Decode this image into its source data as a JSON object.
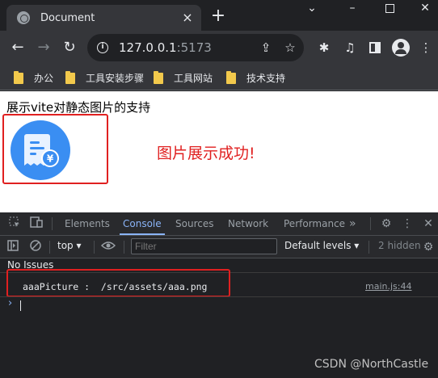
{
  "browser": {
    "tab": {
      "title": "Document"
    },
    "address": {
      "host": "127.0.0.1",
      "port": ":5173"
    },
    "bookmarks": [
      {
        "label": "办公"
      },
      {
        "label": "工具安装步骤"
      },
      {
        "label": "工具网站"
      },
      {
        "label": "技术支持"
      }
    ]
  },
  "page": {
    "heading": "展示vite对静态图片的支持",
    "success_message": "图片展示成功!",
    "logo_icon": "receipt-yen-icon",
    "colors": {
      "highlight": "#e02020",
      "logo_blue": "#3a8ef2",
      "success_text": "#e02020"
    }
  },
  "devtools": {
    "tabs": [
      {
        "label": "Elements"
      },
      {
        "label": "Console"
      },
      {
        "label": "Sources"
      },
      {
        "label": "Network"
      },
      {
        "label": "Performance"
      }
    ],
    "active_tab": "Console",
    "more_tabs": "»",
    "console": {
      "context": "top",
      "filter_placeholder": "Filter",
      "levels": "Default levels",
      "hidden_count": "2 hidden",
      "issues": "No Issues",
      "log": {
        "text": "aaaPicture :  /src/assets/aaa.png",
        "source": "main.js:44"
      }
    }
  },
  "watermark": "CSDN @NorthCastle"
}
